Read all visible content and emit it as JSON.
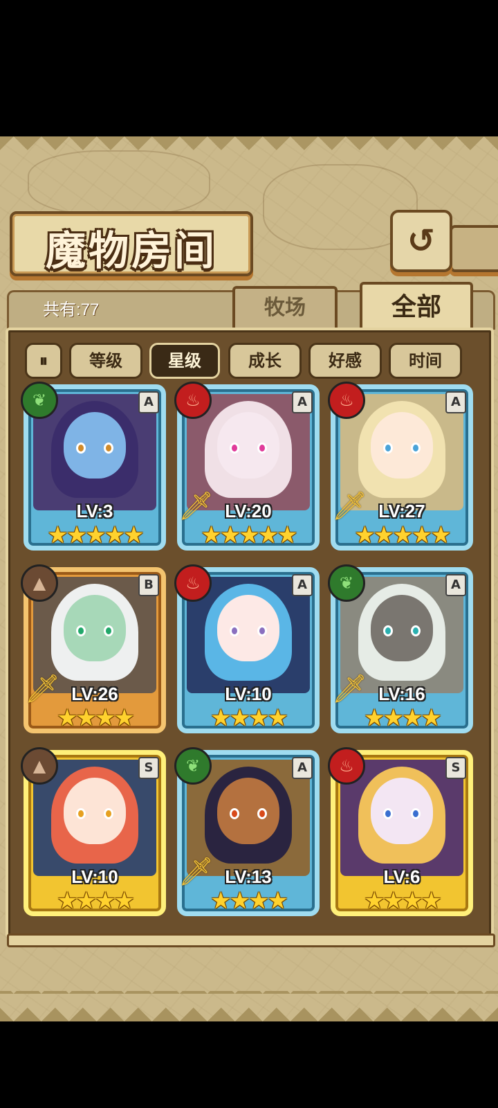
{
  "title": "魔物房间",
  "header": {
    "total_label": "共有:77",
    "back_icon": "return-icon"
  },
  "tabs": [
    {
      "label": "牧场",
      "active": false
    },
    {
      "label": "全部",
      "active": true
    }
  ],
  "sort": {
    "toggle_icon": "sort-order-icon",
    "buttons": [
      {
        "label": "等级",
        "active": false
      },
      {
        "label": "星级",
        "active": true
      },
      {
        "label": "成长",
        "active": false
      },
      {
        "label": "好感",
        "active": false
      },
      {
        "label": "时间",
        "active": false
      }
    ]
  },
  "monsters": [
    {
      "level": "LV:3",
      "stars": "★★★★★",
      "rank": "A",
      "element": "leaf",
      "equipped": false,
      "palette": {
        "bg": "#4a3d73",
        "hair": "#3b2d6b",
        "skin": "#7fb4e6",
        "eye": "#d08a2a"
      }
    },
    {
      "level": "LV:20",
      "stars": "★★★★★",
      "rank": "A",
      "element": "fire",
      "equipped": true,
      "palette": {
        "bg": "#8b5a6b",
        "hair": "#f0e0e6",
        "skin": "#f6e8ef",
        "eye": "#e03a9a"
      }
    },
    {
      "level": "LV:27",
      "stars": "★★★★★",
      "rank": "A",
      "element": "fire",
      "equipped": true,
      "palette": {
        "bg": "#c9b98a",
        "hair": "#f1e2b0",
        "skin": "#fde9d8",
        "eye": "#4aa3d8"
      }
    },
    {
      "level": "LV:26",
      "stars": "★★★★",
      "rank": "B",
      "element": "earth",
      "equipped": true,
      "palette": {
        "bg": "#6b5a4a",
        "hair": "#eef0f0",
        "skin": "#a7d8b8",
        "eye": "#21a86a"
      }
    },
    {
      "level": "LV:10",
      "stars": "★★★★",
      "rank": "A",
      "element": "fire",
      "equipped": false,
      "palette": {
        "bg": "#2a3e6b",
        "hair": "#5ab6e6",
        "skin": "#fde9e6",
        "eye": "#8a6fbf"
      }
    },
    {
      "level": "LV:16",
      "stars": "★★★★",
      "rank": "A",
      "element": "leaf",
      "equipped": true,
      "palette": {
        "bg": "#8a8a80",
        "hair": "#e6ece6",
        "skin": "#7a7670",
        "eye": "#2ab0b0"
      }
    },
    {
      "level": "LV:10",
      "stars": "★★★★",
      "rank": "S",
      "element": "earth",
      "equipped": false,
      "palette": {
        "bg": "#384a6b",
        "hair": "#e8654a",
        "skin": "#fde4d6",
        "eye": "#e6a020"
      }
    },
    {
      "level": "LV:13",
      "stars": "★★★★",
      "rank": "A",
      "element": "leaf",
      "equipped": true,
      "palette": {
        "bg": "#8b6a3b",
        "hair": "#2a2440",
        "skin": "#b4713f",
        "eye": "#d84a1a"
      }
    },
    {
      "level": "LV:6",
      "stars": "★★★★",
      "rank": "S",
      "element": "fire",
      "equipped": false,
      "palette": {
        "bg": "#5a3a6b",
        "hair": "#f0c05a",
        "skin": "#f3e6f3",
        "eye": "#3a6fd0"
      }
    }
  ]
}
